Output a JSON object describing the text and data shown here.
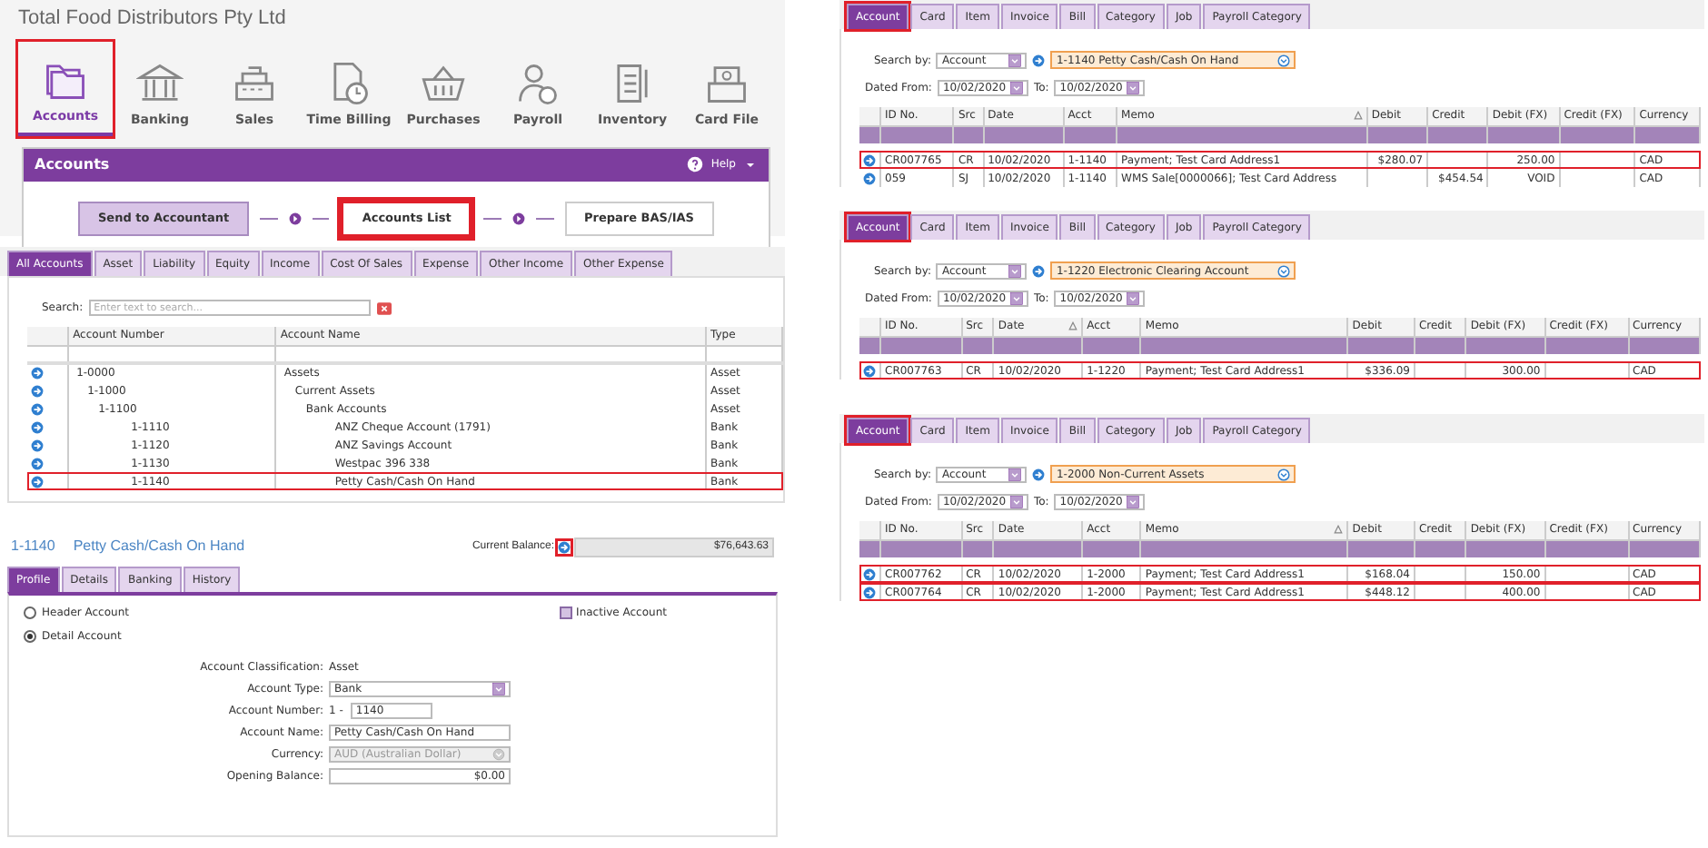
{
  "company": "Total Food Distributors Pty Ltd",
  "modules": [
    {
      "label": "Accounts",
      "selected": true,
      "highlighted": true
    },
    {
      "label": "Banking",
      "selected": false,
      "highlighted": false
    },
    {
      "label": "Sales",
      "selected": false,
      "highlighted": false
    },
    {
      "label": "Time Billing",
      "selected": false,
      "highlighted": false
    },
    {
      "label": "Purchases",
      "selected": false,
      "highlighted": false
    },
    {
      "label": "Payroll",
      "selected": false,
      "highlighted": false
    },
    {
      "label": "Inventory",
      "selected": false,
      "highlighted": false
    },
    {
      "label": "Card File",
      "selected": false,
      "highlighted": false
    }
  ],
  "command_centre": {
    "title": "Accounts",
    "help": "Help",
    "steps": [
      {
        "label": "Send to Accountant",
        "kind": "shaded",
        "highlighted": false
      },
      {
        "label": "Accounts List",
        "kind": "plain",
        "highlighted": true
      },
      {
        "label": "Prepare BAS/IAS",
        "kind": "plain",
        "highlighted": false
      }
    ]
  },
  "accounts_list": {
    "tabs": [
      {
        "label": "All Accounts",
        "selected": true
      },
      {
        "label": "Asset",
        "selected": false
      },
      {
        "label": "Liability",
        "selected": false
      },
      {
        "label": "Equity",
        "selected": false
      },
      {
        "label": "Income",
        "selected": false
      },
      {
        "label": "Cost Of Sales",
        "selected": false
      },
      {
        "label": "Expense",
        "selected": false
      },
      {
        "label": "Other Income",
        "selected": false
      },
      {
        "label": "Other Expense",
        "selected": false
      }
    ],
    "search": {
      "label": "Search:",
      "placeholder": "Enter text to search..."
    },
    "columns": [
      "Account Number",
      "Account Name",
      "Type"
    ],
    "rows": [
      {
        "number": "1-0000",
        "name": "Assets",
        "type": "Asset",
        "kind": "header",
        "highlighted": false,
        "children": [
          {
            "number": "1-1000",
            "name": "Current Assets",
            "type": "Asset",
            "kind": "header",
            "highlighted": false,
            "children": [
              {
                "number": "1-1100",
                "name": "Bank Accounts",
                "type": "Asset",
                "kind": "header",
                "highlighted": false,
                "children": [
                  {
                    "number": "1-1110",
                    "name": "ANZ Cheque Account (1791)",
                    "type": "Bank",
                    "kind": "detail",
                    "highlighted": false
                  },
                  {
                    "number": "1-1120",
                    "name": "ANZ Savings Account",
                    "type": "Bank",
                    "kind": "detail",
                    "highlighted": false
                  },
                  {
                    "number": "1-1130",
                    "name": "Westpac 396 338",
                    "type": "Bank",
                    "kind": "detail",
                    "highlighted": false
                  },
                  {
                    "number": "1-1140",
                    "name": "Petty Cash/Cash On Hand",
                    "type": "Bank",
                    "kind": "detail",
                    "highlighted": true
                  }
                ]
              }
            ]
          }
        ]
      }
    ]
  },
  "account_detail": {
    "number": "1-1140",
    "name": "Petty Cash/Cash On Hand",
    "balance_label": "Current Balance:",
    "balance_link_highlighted": true,
    "balance": "$76,643.63",
    "tabs": [
      {
        "label": "Profile",
        "selected": true
      },
      {
        "label": "Details",
        "selected": false
      },
      {
        "label": "Banking",
        "selected": false
      },
      {
        "label": "History",
        "selected": false
      }
    ],
    "radios": [
      {
        "label": "Header Account",
        "selected": false
      },
      {
        "label": "Detail Account",
        "selected": true
      }
    ],
    "inactive": {
      "label": "Inactive Account",
      "checked": false
    },
    "fields": [
      {
        "label": "Account Classification:",
        "value": "Asset",
        "kind": "text"
      },
      {
        "label": "Account Type:",
        "value": "Bank",
        "kind": "select"
      },
      {
        "label": "Account Number:",
        "prefix": "1 -",
        "value": "1140",
        "kind": "number"
      },
      {
        "label": "Account Name:",
        "value": "Petty Cash/Cash On Hand",
        "kind": "input"
      },
      {
        "label": "Currency:",
        "value": "AUD (Australian Dollar)",
        "kind": "disabled-select"
      },
      {
        "label": "Opening Balance:",
        "value": "$0.00",
        "kind": "amount"
      }
    ]
  },
  "find_transactions": [
    {
      "tabs": [
        {
          "label": "Account",
          "selected": true,
          "highlighted": true
        },
        {
          "label": "Card",
          "selected": false,
          "highlighted": false
        },
        {
          "label": "Item",
          "selected": false,
          "highlighted": false
        },
        {
          "label": "Invoice",
          "selected": false,
          "highlighted": false
        },
        {
          "label": "Bill",
          "selected": false,
          "highlighted": false
        },
        {
          "label": "Category",
          "selected": false,
          "highlighted": false
        },
        {
          "label": "Job",
          "selected": false,
          "highlighted": false
        },
        {
          "label": "Payroll Category",
          "selected": false,
          "highlighted": false
        }
      ],
      "search_by_label": "Search by:",
      "search_by": "Account",
      "account": "1-1140 Petty Cash/Cash On Hand",
      "from_label": "Dated From:",
      "from": "10/02/2020",
      "to_label": "To:",
      "to": "10/02/2020",
      "columns": [
        {
          "label": "ID No.",
          "sorted": false
        },
        {
          "label": "Src",
          "sorted": false
        },
        {
          "label": "Date",
          "sorted": false
        },
        {
          "label": "Acct",
          "sorted": false
        },
        {
          "label": "Memo",
          "sorted": true
        },
        {
          "label": "Debit",
          "sorted": false
        },
        {
          "label": "Credit",
          "sorted": false
        },
        {
          "label": "Debit (FX)",
          "sorted": false
        },
        {
          "label": "Credit (FX)",
          "sorted": false
        },
        {
          "label": "Currency",
          "sorted": false
        }
      ],
      "rows": [
        {
          "cells": [
            "CR007765",
            "CR",
            "10/02/2020",
            "1-1140",
            "Payment; Test Card Address1",
            "$280.07",
            "",
            "250.00",
            "",
            "CAD"
          ],
          "highlighted": true
        },
        {
          "cells": [
            "059",
            "SJ",
            "10/02/2020",
            "1-1140",
            "WMS Sale[0000066]; Test Card Address",
            "",
            "$454.54",
            "VOID",
            "",
            "CAD"
          ],
          "highlighted": false
        }
      ]
    },
    {
      "tabs": [
        {
          "label": "Account",
          "selected": true,
          "highlighted": true
        },
        {
          "label": "Card",
          "selected": false,
          "highlighted": false
        },
        {
          "label": "Item",
          "selected": false,
          "highlighted": false
        },
        {
          "label": "Invoice",
          "selected": false,
          "highlighted": false
        },
        {
          "label": "Bill",
          "selected": false,
          "highlighted": false
        },
        {
          "label": "Category",
          "selected": false,
          "highlighted": false
        },
        {
          "label": "Job",
          "selected": false,
          "highlighted": false
        },
        {
          "label": "Payroll Category",
          "selected": false,
          "highlighted": false
        }
      ],
      "search_by_label": "Search by:",
      "search_by": "Account",
      "account": "1-1220 Electronic Clearing Account",
      "from_label": "Dated From:",
      "from": "10/02/2020",
      "to_label": "To:",
      "to": "10/02/2020",
      "columns": [
        {
          "label": "ID No.",
          "sorted": false
        },
        {
          "label": "Src",
          "sorted": false
        },
        {
          "label": "Date",
          "sorted": true
        },
        {
          "label": "Acct",
          "sorted": false
        },
        {
          "label": "Memo",
          "sorted": false
        },
        {
          "label": "Debit",
          "sorted": false
        },
        {
          "label": "Credit",
          "sorted": false
        },
        {
          "label": "Debit (FX)",
          "sorted": false
        },
        {
          "label": "Credit (FX)",
          "sorted": false
        },
        {
          "label": "Currency",
          "sorted": false
        }
      ],
      "rows": [
        {
          "cells": [
            "CR007763",
            "CR",
            "10/02/2020",
            "1-1220",
            "Payment; Test Card Address1",
            "$336.09",
            "",
            "300.00",
            "",
            "CAD"
          ],
          "highlighted": true
        }
      ]
    },
    {
      "tabs": [
        {
          "label": "Account",
          "selected": true,
          "highlighted": true
        },
        {
          "label": "Card",
          "selected": false,
          "highlighted": false
        },
        {
          "label": "Item",
          "selected": false,
          "highlighted": false
        },
        {
          "label": "Invoice",
          "selected": false,
          "highlighted": false
        },
        {
          "label": "Bill",
          "selected": false,
          "highlighted": false
        },
        {
          "label": "Category",
          "selected": false,
          "highlighted": false
        },
        {
          "label": "Job",
          "selected": false,
          "highlighted": false
        },
        {
          "label": "Payroll Category",
          "selected": false,
          "highlighted": false
        }
      ],
      "search_by_label": "Search by:",
      "search_by": "Account",
      "account": "1-2000 Non-Current Assets",
      "from_label": "Dated From:",
      "from": "10/02/2020",
      "to_label": "To:",
      "to": "10/02/2020",
      "columns": [
        {
          "label": "ID No.",
          "sorted": false
        },
        {
          "label": "Src",
          "sorted": false
        },
        {
          "label": "Date",
          "sorted": false
        },
        {
          "label": "Acct",
          "sorted": false
        },
        {
          "label": "Memo",
          "sorted": true
        },
        {
          "label": "Debit",
          "sorted": false
        },
        {
          "label": "Credit",
          "sorted": false
        },
        {
          "label": "Debit (FX)",
          "sorted": false
        },
        {
          "label": "Credit (FX)",
          "sorted": false
        },
        {
          "label": "Currency",
          "sorted": false
        }
      ],
      "rows": [
        {
          "cells": [
            "CR007762",
            "CR",
            "10/02/2020",
            "1-2000",
            "Payment; Test Card Address1",
            "$168.04",
            "",
            "150.00",
            "",
            "CAD"
          ],
          "highlighted": true
        },
        {
          "cells": [
            "CR007764",
            "CR",
            "10/02/2020",
            "1-2000",
            "Payment; Test Card Address1",
            "$448.12",
            "",
            "400.00",
            "",
            "CAD"
          ],
          "highlighted": true
        }
      ]
    }
  ]
}
